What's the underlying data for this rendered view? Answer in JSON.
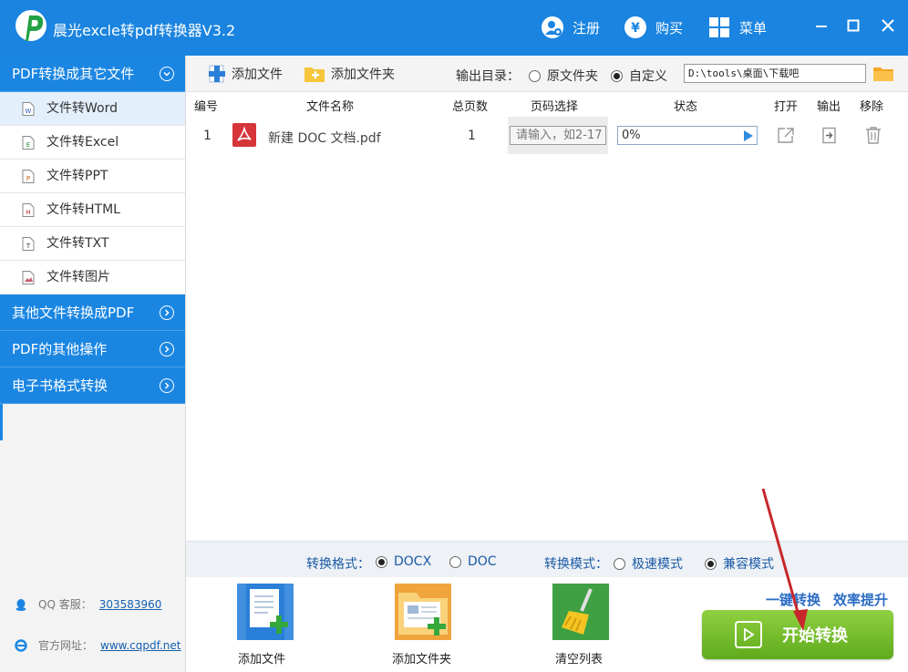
{
  "app": {
    "title": "晨光excle转pdf转换器V3.2"
  },
  "titlebar": {
    "register_label": "注册",
    "buy_label": "购买",
    "menu_label": "菜单"
  },
  "sidebar": {
    "categories": [
      {
        "label": "PDF转换成其它文件",
        "expanded": true
      },
      {
        "label": "其他文件转换成PDF",
        "expanded": false
      },
      {
        "label": "PDF的其他操作",
        "expanded": false
      },
      {
        "label": "电子书格式转换",
        "expanded": false
      }
    ],
    "sub_items": [
      {
        "label": "文件转Word",
        "icon": "word-file-icon",
        "active": true
      },
      {
        "label": "文件转Excel",
        "icon": "excel-file-icon",
        "active": false
      },
      {
        "label": "文件转PPT",
        "icon": "ppt-file-icon",
        "active": false
      },
      {
        "label": "文件转HTML",
        "icon": "html-file-icon",
        "active": false
      },
      {
        "label": "文件转TXT",
        "icon": "txt-file-icon",
        "active": false
      },
      {
        "label": "文件转图片",
        "icon": "image-file-icon",
        "active": false
      }
    ],
    "qq_label": "QQ 客服：",
    "qq_value": "303583960",
    "site_label": "官方网址：",
    "site_value": "www.cqpdf.net"
  },
  "toolbar": {
    "add_file_label": "添加文件",
    "add_folder_label": "添加文件夹",
    "output_dir_label": "输出目录：",
    "original_folder_label": "原文件夹",
    "custom_label": "自定义",
    "output_selected": "custom",
    "path_value": "D:\\tools\\桌面\\下载吧"
  },
  "table": {
    "headers": [
      "编号",
      "文件名称",
      "总页数",
      "页码选择",
      "状态",
      "打开",
      "输出",
      "移除"
    ],
    "rows": [
      {
        "index": "1",
        "filename": "新建 DOC 文档.pdf",
        "pages": "1",
        "page_placeholder": "请输入，如2-17",
        "progress_text": "0%",
        "progress": 0
      }
    ]
  },
  "options": {
    "format_label": "转换格式：",
    "format_docx": "DOCX",
    "format_doc": "DOC",
    "format_selected": "DOCX",
    "mode_label": "转换模式：",
    "mode_fast": "极速模式",
    "mode_compat": "兼容模式",
    "mode_selected": "兼容模式"
  },
  "actions": {
    "add_file_label": "添加文件",
    "add_folder_label": "添加文件夹",
    "clear_list_label": "清空列表",
    "slogan_1": "一键转换",
    "slogan_2": "效率提升",
    "start_label": "开始转换"
  },
  "colors": {
    "brand_blue": "#1a84e0",
    "start_green": "#6fbb2a",
    "annotation_red": "#c8282b"
  }
}
